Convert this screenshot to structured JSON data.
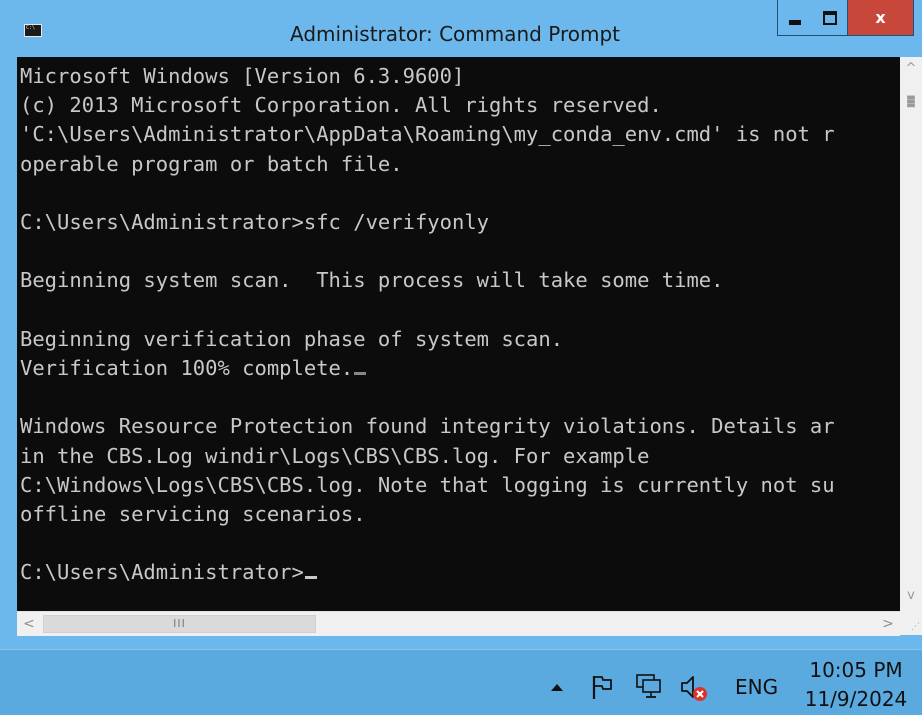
{
  "window": {
    "title": "Administrator: Command Prompt",
    "buttons": {
      "minimize": "_",
      "maximize": "□",
      "close": "x"
    },
    "icon": "cmd-app-icon"
  },
  "console": {
    "lines": [
      "Microsoft Windows [Version 6.3.9600]",
      "(c) 2013 Microsoft Corporation. All rights reserved.",
      "'C:\\Users\\Administrator\\AppData\\Roaming\\my_conda_env.cmd' is not r",
      "operable program or batch file.",
      "",
      "C:\\Users\\Administrator>sfc /verifyonly",
      "",
      "Beginning system scan.  This process will take some time.",
      "",
      "Beginning verification phase of system scan.",
      "Verification 100% complete.",
      "",
      "Windows Resource Protection found integrity violations. Details ar",
      "in the CBS.Log windir\\Logs\\CBS\\CBS.log. For example",
      "C:\\Windows\\Logs\\CBS\\CBS.log. Note that logging is currently not su",
      "offline servicing scenarios.",
      "",
      "C:\\Users\\Administrator>"
    ],
    "colors": {
      "background": "#0c0c0c",
      "text": "#c8c8c8"
    }
  },
  "scrollbar": {
    "up": "^",
    "down": "v",
    "left": "<",
    "right": ">",
    "grip": "III"
  },
  "taskbar": {
    "language": "ENG",
    "time": "10:05 PM",
    "date": "11/9/2024",
    "icons": [
      "show-hidden-icons-arrow-icon",
      "action-center-flag-icon",
      "network-icon",
      "volume-muted-icon"
    ],
    "colors": {
      "background": "#5aa9df"
    }
  }
}
